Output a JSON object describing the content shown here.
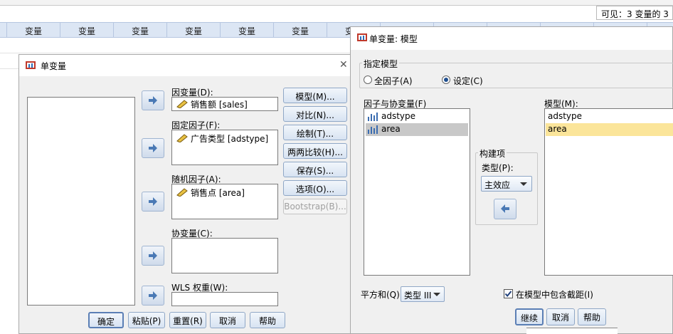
{
  "sheet": {
    "visible_text": "可见：3 变量的 3",
    "column_header": "变量"
  },
  "univariate": {
    "title": "单变量",
    "close_symbol": "✕",
    "dependent_label": "因变量(D):",
    "dependent_value": "销售额 [sales]",
    "fixed_label": "固定因子(F):",
    "fixed_value": "广告类型 [adstype]",
    "random_label": "随机因子(A):",
    "random_value": "销售点 [area]",
    "covariate_label": "协变量(C):",
    "wls_label": "WLS 权重(W):",
    "side_buttons": [
      "模型(M)...",
      "对比(N)...",
      "绘制(T)...",
      "两两比较(H)...",
      "保存(S)...",
      "选项(O)...",
      "Bootstrap(B)..."
    ],
    "ok": "确定",
    "paste": "粘贴(P)",
    "reset": "重置(R)",
    "cancel": "取消",
    "help": "帮助"
  },
  "model": {
    "title": "单变量: 模型",
    "specify_legend": "指定模型",
    "full_factorial": "全因子(A)",
    "custom": "设定(C)",
    "factors_label": "因子与协变量(F)",
    "factors": [
      "adstype",
      "area"
    ],
    "build_legend": "构建项",
    "type_label": "类型(P):",
    "type_value": "主效应",
    "model_label": "模型(M):",
    "model_items": [
      "adstype",
      "area"
    ],
    "ss_label": "平方和(Q)",
    "ss_value": "类型 III",
    "intercept_label": "在模型中包含截距(I)",
    "intercept_checked": true,
    "continue": "继续",
    "cancel": "取消",
    "help": "帮助"
  },
  "colors": {
    "header_bg": "#dce6f4",
    "selection": "#c8c8c8",
    "model_highlight": "#fbe59a",
    "button_border": "#8fa7c6"
  }
}
